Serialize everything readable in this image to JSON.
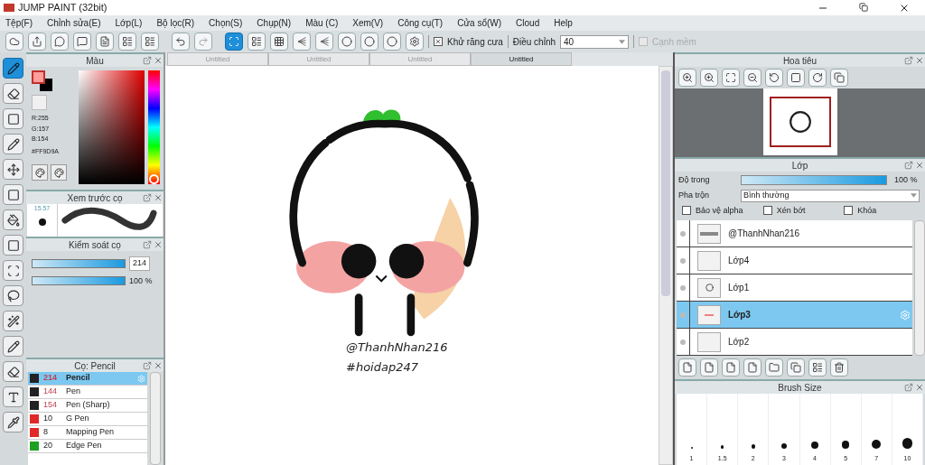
{
  "window": {
    "title": "JUMP PAINT (32bit)"
  },
  "menu": [
    "Tệp(F)",
    "Chỉnh sửa(E)",
    "Lớp(L)",
    "Bộ lọc(R)",
    "Chọn(S)",
    "Chụp(N)",
    "Màu (C)",
    "Xem(V)",
    "Công cụ(T)",
    "Cửa sổ(W)",
    "Cloud",
    "Help"
  ],
  "toolbar": {
    "snap_modes": [
      {
        "selected": true
      },
      {
        "selected": false
      },
      {
        "selected": false
      },
      {
        "selected": false
      },
      {
        "selected": false
      },
      {
        "selected": false
      },
      {
        "selected": false
      },
      {
        "selected": false
      },
      {
        "selected": false
      }
    ],
    "antialias": {
      "label": "Khử răng cưa",
      "checked": true
    },
    "adjust": {
      "label": "Điều chỉnh",
      "value": "40"
    },
    "smooth_edge": {
      "label": "Cạnh mềm",
      "checked": false,
      "disabled": true
    }
  },
  "tools": [
    {
      "selected": true
    },
    {
      "selected": false
    },
    {
      "selected": false
    },
    {
      "selected": false
    },
    {
      "selected": false
    },
    {
      "selected": false
    },
    {
      "selected": false
    },
    {
      "selected": false
    },
    {
      "selected": false
    },
    {
      "selected": false
    },
    {
      "selected": false
    },
    {
      "selected": false
    },
    {
      "selected": false
    },
    {
      "selected": false
    },
    {
      "selected": false
    }
  ],
  "color_panel": {
    "title": "Màu",
    "color": "#ff9d9a",
    "hue": {
      "level": 0
    },
    "r": "R:255",
    "g": "G:157",
    "b": "B:154",
    "hex": "#FF9D9A"
  },
  "brush_preview": {
    "title": "Xem trước cọ",
    "size": "15.57"
  },
  "brush_control": {
    "title": "Kiểm soát cọ",
    "sliders": [
      {
        "level": 1,
        "reading": "214",
        "kind": "field"
      },
      {
        "level": 1,
        "reading": "100 %",
        "kind": "text"
      }
    ]
  },
  "brush_list": {
    "title": "Cọ: Pencil",
    "items": [
      {
        "size": "214",
        "name": "Pencil",
        "color": "#222222",
        "selected": true
      },
      {
        "size": "144",
        "name": "Pen",
        "color": "#222222",
        "selected": false
      },
      {
        "size": "154",
        "name": "Pen (Sharp)",
        "color": "#222222",
        "selected": false
      },
      {
        "size": "10",
        "name": "G Pen",
        "color": "#e02828",
        "selected": false
      },
      {
        "size": "8",
        "name": "Mapping Pen",
        "color": "#e02828",
        "selected": false
      },
      {
        "size": "20",
        "name": "Edge Pen",
        "color": "#20a020",
        "selected": false
      }
    ]
  },
  "doc_tabs": [
    {
      "label": "Untitled",
      "selected": false
    },
    {
      "label": "Untitled",
      "selected": false
    },
    {
      "label": "Untitled",
      "selected": false
    },
    {
      "label": "Untitled",
      "selected": true
    }
  ],
  "canvas": {
    "texts": [
      "@ThanhNhan216",
      "#hoidap247"
    ]
  },
  "navigator": {
    "title": "Hoa tiêu"
  },
  "layer_panel": {
    "title": "Lớp",
    "opacity_label": "Độ trong",
    "opacity": {
      "level": 1,
      "reading": "100 %"
    },
    "blend_label": "Pha trộn",
    "blend_value": "Bình thường",
    "options": [
      {
        "label": "Bảo vệ alpha",
        "checked": false
      },
      {
        "label": "Xén bớt",
        "checked": false
      },
      {
        "label": "Khóa",
        "checked": false
      }
    ],
    "layers": [
      {
        "name": "@ThanhNhan216",
        "selected": false,
        "kind": "text"
      },
      {
        "name": "Lớp4",
        "selected": false,
        "kind": "empty"
      },
      {
        "name": "Lớp1",
        "selected": false,
        "kind": "sketch"
      },
      {
        "name": "Lớp3",
        "selected": true,
        "kind": "blush"
      },
      {
        "name": "Lớp2",
        "selected": false,
        "kind": "empty"
      }
    ]
  },
  "brush_size": {
    "title": "Brush Size",
    "sizes": [
      "1",
      "1.5",
      "2",
      "3",
      "4",
      "5",
      "7",
      "10"
    ]
  }
}
